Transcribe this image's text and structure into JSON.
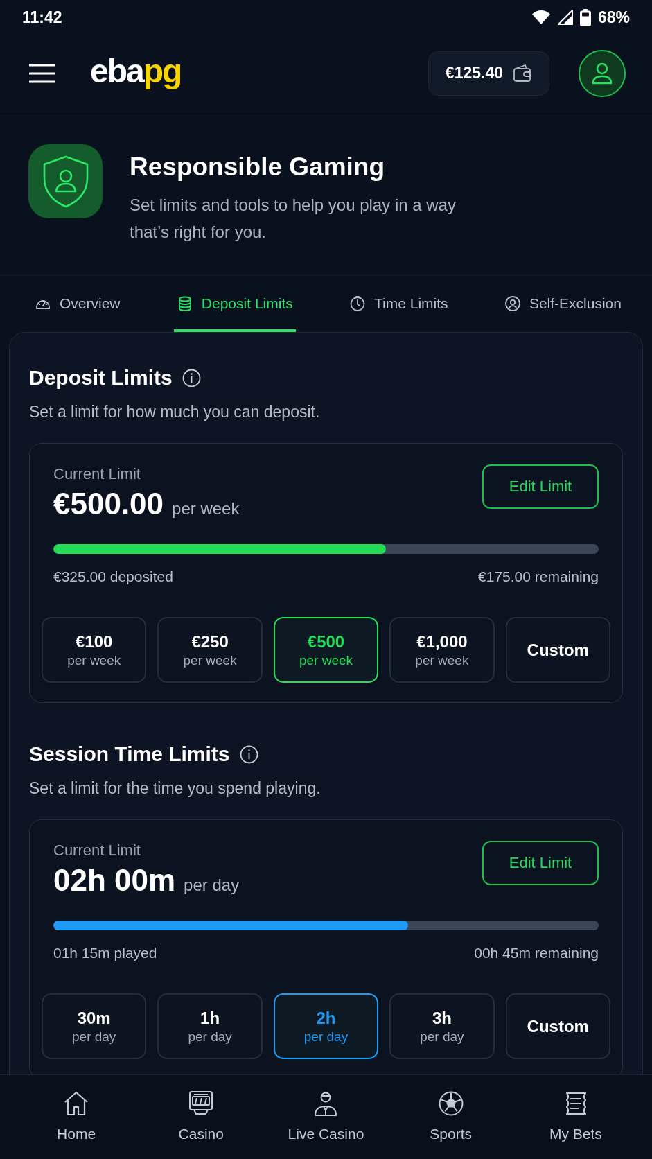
{
  "status_bar": {
    "time": "11:42",
    "battery": "68%"
  },
  "header": {
    "logo": {
      "text": "eba",
      "accent_text": "pg"
    },
    "balance": "€125.40"
  },
  "hero": {
    "title": "Responsible Gaming",
    "subtitle": "Set limits and tools to help you play in a way that’s right for you."
  },
  "tabs": [
    {
      "label": "Overview",
      "selected": false
    },
    {
      "label": "Deposit Limits",
      "selected": true
    },
    {
      "label": "Time Limits",
      "selected": false
    },
    {
      "label": "Self-Exclusion",
      "selected": false
    }
  ],
  "sections": [
    {
      "title": "Deposit Limits",
      "description": "Set a limit for how much you can deposit.",
      "current_label": "Current Limit",
      "amount": "€500.00",
      "period": "per week",
      "edit_button": "Edit Limit",
      "color": "#22dd55",
      "level": 0.61,
      "used": "€325.00 deposited",
      "remaining": "€175.00 remaining",
      "options": [
        {
          "value": "€100",
          "period": "per week",
          "selected": false
        },
        {
          "value": "€250",
          "period": "per week",
          "selected": false
        },
        {
          "value": "€500",
          "period": "per week",
          "selected": true
        },
        {
          "value": "€1,000",
          "period": "per week",
          "selected": false
        },
        {
          "value": "Custom",
          "selected": false
        }
      ]
    },
    {
      "title": "Session Time Limits",
      "description": "Set a limit for the time you spend playing.",
      "current_label": "Current Limit",
      "amount": "02h 00m",
      "period": "per day",
      "edit_button": "Edit Limit",
      "color": "#1e9bf5",
      "level": 0.65,
      "used": "01h 15m played",
      "remaining": "00h 45m remaining",
      "options": [
        {
          "value": "30m",
          "period": "per day",
          "selected": false
        },
        {
          "value": "1h",
          "period": "per day",
          "selected": false
        },
        {
          "value": "2h",
          "period": "per day",
          "selected": true
        },
        {
          "value": "3h",
          "period": "per day",
          "selected": false
        },
        {
          "value": "Custom",
          "selected": false
        }
      ]
    }
  ],
  "bottom_nav": [
    {
      "label": "Home"
    },
    {
      "label": "Casino"
    },
    {
      "label": "Live Casino"
    },
    {
      "label": "Sports"
    },
    {
      "label": "My Bets"
    }
  ]
}
